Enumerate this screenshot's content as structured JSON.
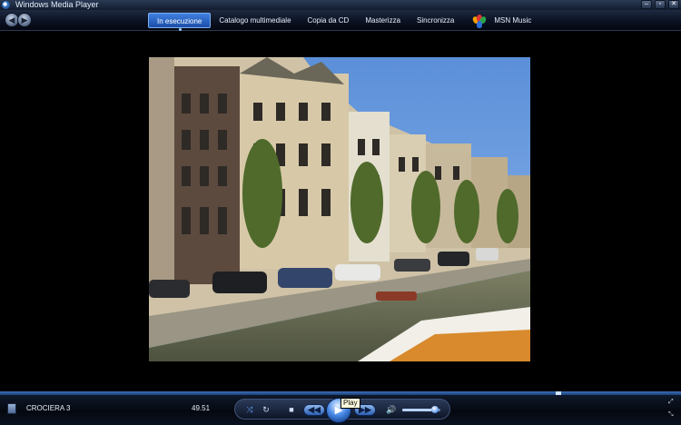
{
  "window": {
    "title": "Windows Media Player",
    "controls": [
      "–",
      "▫",
      "✕"
    ]
  },
  "nav": {
    "back_icon": "back-arrow-icon",
    "forward_icon": "forward-arrow-icon",
    "tabs": [
      {
        "label": "In esecuzione",
        "active": true
      },
      {
        "label": "Catalogo multimediale",
        "active": false
      },
      {
        "label": "Copia da CD",
        "active": false
      },
      {
        "label": "Masterizza",
        "active": false
      },
      {
        "label": "Sincronizza",
        "active": false
      }
    ],
    "msn_label": "MSN Music"
  },
  "now_playing": {
    "track": "CROCIERA 3",
    "time": "49.51",
    "seek_progress": 0.82
  },
  "transport": {
    "shuffle_glyph": "⤨",
    "repeat_glyph": "↻",
    "stop_glyph": "■",
    "prev_glyph": "◀◀",
    "play_glyph": "▶",
    "next_glyph": "▶▶",
    "volume_glyph": "🔊",
    "volume_level": 0.85,
    "tooltip": "Play"
  },
  "colors": {
    "accent": "#2b6fd6",
    "background": "#000000"
  }
}
